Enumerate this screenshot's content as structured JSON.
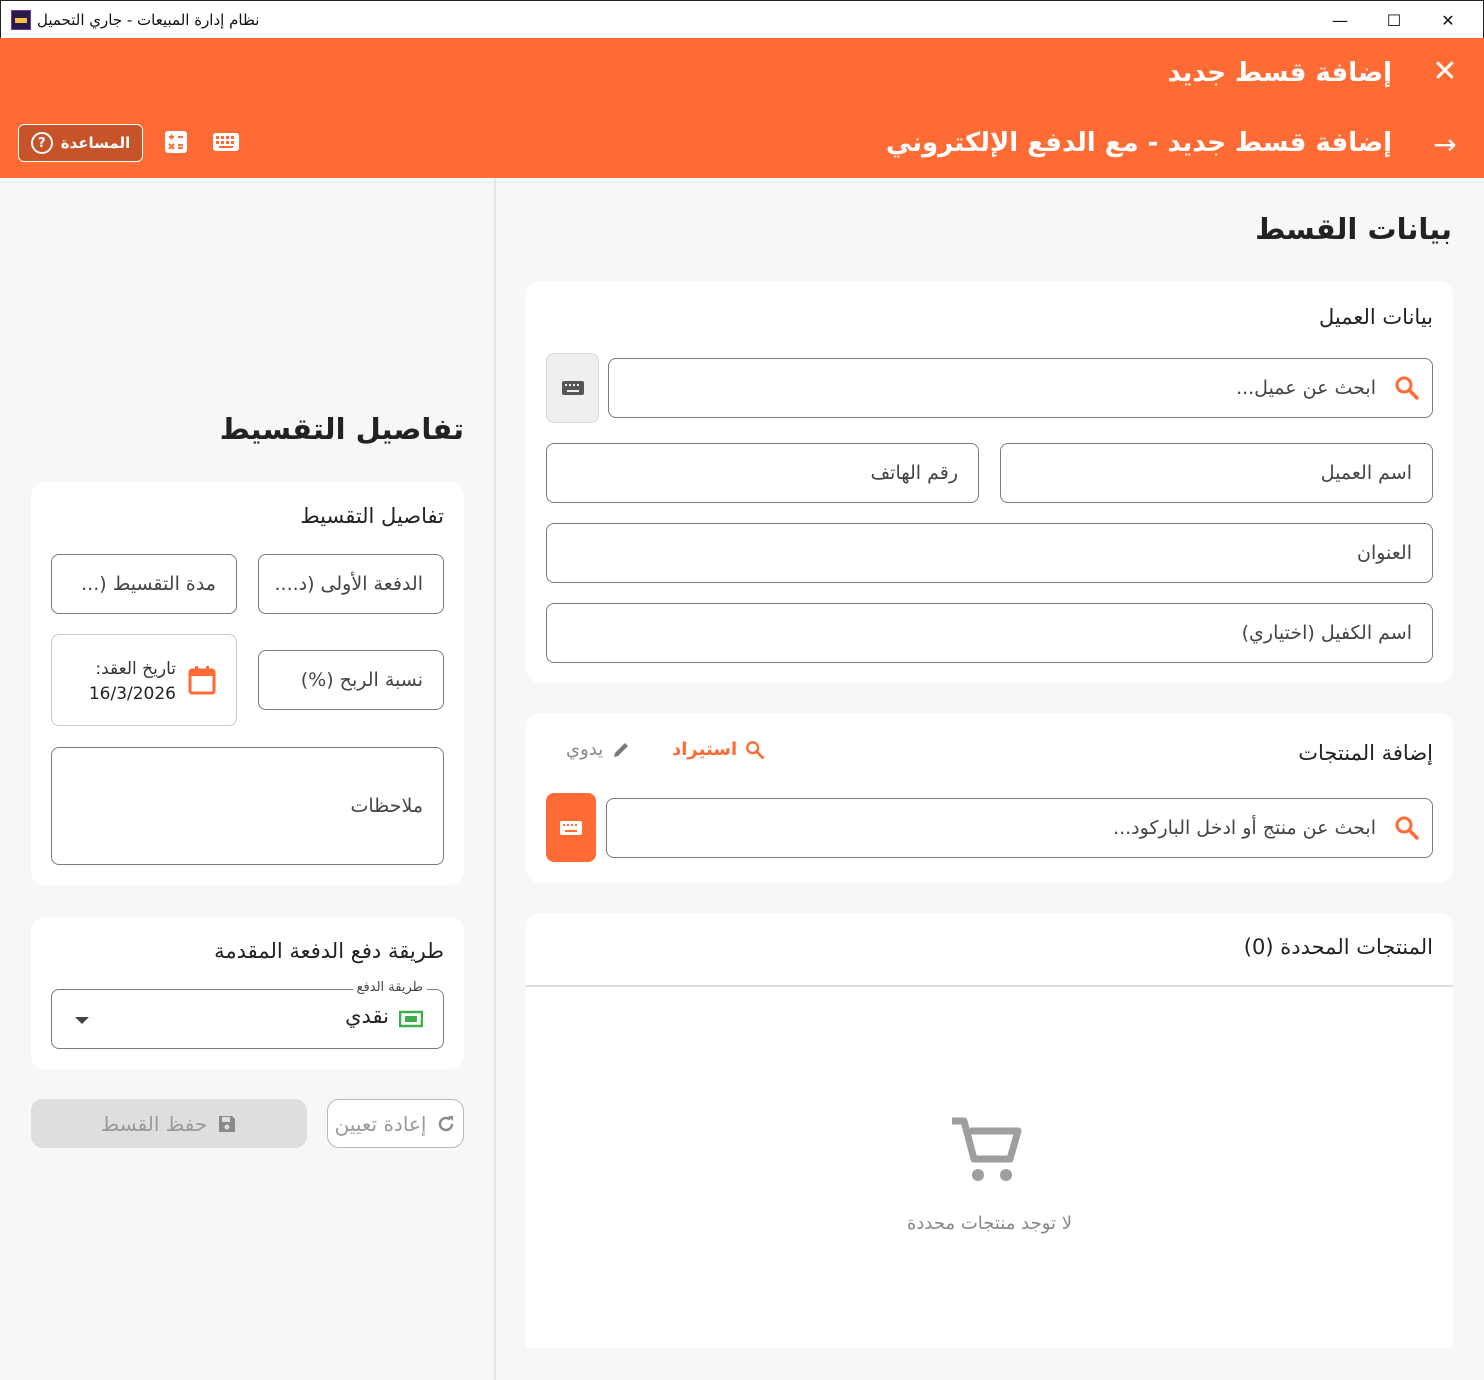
{
  "window": {
    "title": "نظام إدارة المبيعات - جاري التحميل",
    "controls": {
      "minimize": "—",
      "maximize": "☐",
      "close": "✕"
    }
  },
  "header": {
    "title": "إضافة قسط جديد",
    "subtitle": "إضافة قسط جديد - مع الدفع الإلكتروني",
    "help_label": "المساعدة",
    "accent_color": "#ff6b35"
  },
  "installment_data": {
    "section_title": "بيانات القسط",
    "customer": {
      "card_title": "بيانات العميل",
      "search_placeholder": "ابحث عن عميل...",
      "name_label": "اسم العميل",
      "phone_label": "رقم الهاتف",
      "address_label": "العنوان",
      "guarantor_label": "اسم الكفيل (اختياري)"
    },
    "products": {
      "card_title": "إضافة المنتجات",
      "mode_import": "استيراد",
      "mode_manual": "يدوي",
      "search_placeholder": "ابحث عن منتج أو ادخل الباركود..."
    },
    "selected": {
      "card_title": "المنتجات المحددة (0)",
      "empty_text": "لا توجد منتجات محددة"
    }
  },
  "installment_details": {
    "section_title": "تفاصيل التقسيط",
    "card_title": "تفاصيل التقسيط",
    "down_payment_label": "الدفعة الأولى (د....",
    "duration_label": "مدة التقسيط (...",
    "profit_label": "نسبة الربح (%)",
    "contract_date_label": "تاريخ العقد:",
    "contract_date_value": "16/3/2026",
    "notes_label": "ملاحظات"
  },
  "payment_method": {
    "card_title": "طريقة دفع الدفعة المقدمة",
    "field_label": "طريقة الدفع",
    "selected_value": "نقدي"
  },
  "actions": {
    "save_label": "حفظ القسط",
    "reset_label": "إعادة تعيين"
  }
}
